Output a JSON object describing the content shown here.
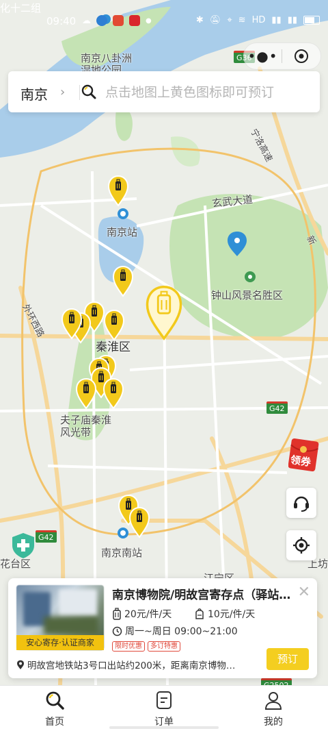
{
  "status_bar": {
    "carrier_label": "化十二组",
    "time": "09:40",
    "network_label": "HD"
  },
  "map": {
    "labels": {
      "bagua_wetland": "南京八卦洲\n湿地公园",
      "nanjing_station": "南京站",
      "xuanwu_avenue": "玄武大道",
      "zhongshan": "钟山风景名胜区",
      "qinhuai": "秦淮区",
      "fuzimiao": "夫子庙秦淮\n风光带",
      "nanjing_south": "南京南站",
      "ningluo_expressway": "宁洛高速",
      "outer_ring": "外环西路",
      "jiangning": "江宁区",
      "yuhuatai": "花台区",
      "shangfang": "上坊",
      "right_edge": "新"
    },
    "shields": {
      "g36": "G36",
      "g42_right": "G42",
      "g42_left": "G42",
      "g2502": "G2502"
    }
  },
  "search": {
    "city": "南京",
    "placeholder": "点击地图上黄色图标即可预订"
  },
  "promo": {
    "red_packet_label": "领券"
  },
  "card": {
    "badge": "安心寄存·认证商家",
    "title": "南京博物院/明故宫寄存点（驿站…",
    "price_small": "20元/件/天",
    "price_large": "10元/件/天",
    "hours": "周一~周日 09:00~21:00",
    "tags": [
      "限时优惠",
      "多订特惠"
    ],
    "address": "明故宫地铁站3号口出站约200米，距离南京博物…",
    "book_label": "预订"
  },
  "tabs": [
    {
      "label": "首页",
      "icon": "home-search-icon",
      "active": true
    },
    {
      "label": "订单",
      "icon": "order-icon",
      "active": false
    },
    {
      "label": "我的",
      "icon": "profile-icon",
      "active": false
    }
  ],
  "colors": {
    "accent": "#f4ce20",
    "pin_yellow": "#f2c91b",
    "water": "#a9cdea",
    "park": "#c5e3b4",
    "road": "#f6d79a"
  }
}
